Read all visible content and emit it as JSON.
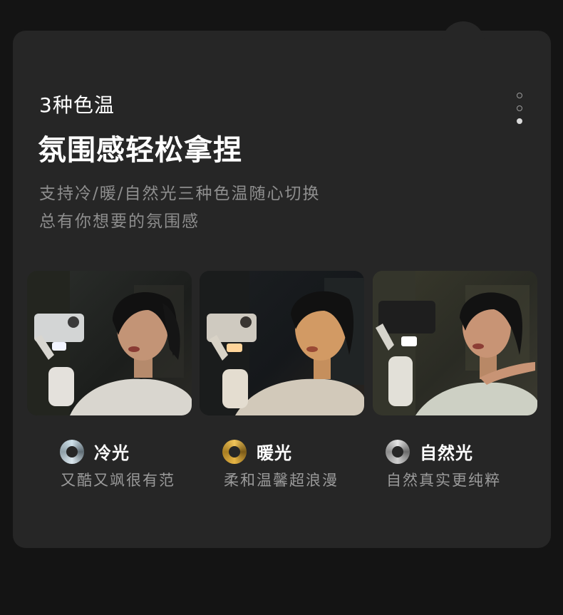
{
  "eyebrow": "3种色温",
  "headline": "氛围感轻松拿捏",
  "description": {
    "line1": "支持冷/暖/自然光三种色温随心切换",
    "line2": "总有你想要的氛围感"
  },
  "pagination": {
    "total": 3,
    "active_index": 2
  },
  "modes": [
    {
      "title": "冷光",
      "subtitle": "又酷又飒很有范",
      "icon": "cool-light-ring-icon",
      "accent": "#cfe1ea"
    },
    {
      "title": "暖光",
      "subtitle": "柔和温馨超浪漫",
      "icon": "warm-light-ring-icon",
      "accent": "#f0c45a"
    },
    {
      "title": "自然光",
      "subtitle": "自然真实更纯粹",
      "icon": "natural-light-ring-icon",
      "accent": "#e6e6e6"
    }
  ],
  "colors": {
    "background": "#141414",
    "card": "#262626",
    "text_primary": "#ffffff",
    "text_secondary": "#8e8e8e"
  }
}
